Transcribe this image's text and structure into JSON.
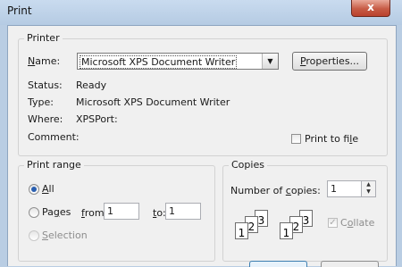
{
  "window": {
    "title": "Print",
    "close_label": "x"
  },
  "printer": {
    "legend": "Printer",
    "name_label": "Name:",
    "name_value": "Microsoft XPS Document Writer",
    "properties_button": "Properties...",
    "status_label": "Status:",
    "status_value": "Ready",
    "type_label": "Type:",
    "type_value": "Microsoft XPS Document Writer",
    "where_label": "Where:",
    "where_value": "XPSPort:",
    "comment_label": "Comment:",
    "print_to_file_label": "Print to file"
  },
  "print_range": {
    "legend": "Print range",
    "all_label": "All",
    "pages_label": "Pages",
    "from_label": "from:",
    "from_value": "1",
    "to_label": "to:",
    "to_value": "1",
    "selection_label": "Selection"
  },
  "copies": {
    "legend": "Copies",
    "number_label": "Number of copies:",
    "number_value": "1",
    "collate_label": "Collate",
    "collate_pages": [
      "1",
      "2",
      "3"
    ]
  }
}
